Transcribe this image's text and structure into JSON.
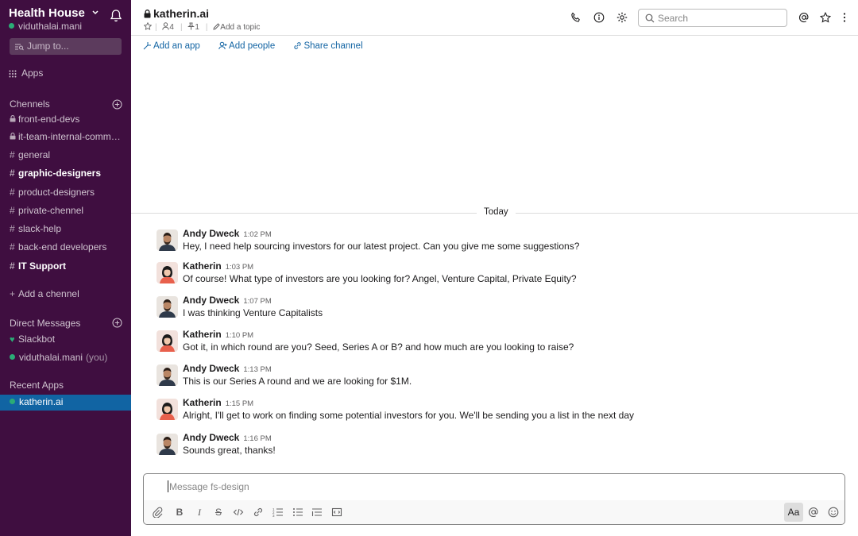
{
  "workspace": {
    "name": "Health House",
    "user": "viduthalai.mani"
  },
  "jump": {
    "label": "Jump to..."
  },
  "apps": {
    "label": "Apps"
  },
  "channels": {
    "title": "Chennels",
    "items": [
      {
        "prefix": "lock",
        "label": "front-end-devs",
        "bold": false
      },
      {
        "prefix": "lock",
        "label": "it-team-internal-commu...",
        "bold": false
      },
      {
        "prefix": "#",
        "label": "general",
        "bold": false
      },
      {
        "prefix": "#",
        "label": "graphic-designers",
        "bold": true
      },
      {
        "prefix": "#",
        "label": "product-designers",
        "bold": false
      },
      {
        "prefix": "#",
        "label": "private-chennel",
        "bold": false
      },
      {
        "prefix": "#",
        "label": "slack-help",
        "bold": false
      },
      {
        "prefix": "#",
        "label": "back-end developers",
        "bold": false
      },
      {
        "prefix": "#",
        "label": "IT Support",
        "bold": true
      }
    ],
    "add_label": "Add a chennel"
  },
  "direct_messages": {
    "title": "Direct Messages",
    "items": [
      {
        "label": "Slackbot"
      },
      {
        "label": "viduthalai.mani",
        "suffix": "(you)"
      }
    ]
  },
  "recent_apps": {
    "title": "Recent Apps",
    "items": [
      {
        "label": "katherin.ai",
        "active": true
      }
    ]
  },
  "header": {
    "channel": "katherin.ai",
    "members": "4",
    "pins": "1",
    "topic": "Add a topic",
    "search_placeholder": "Search"
  },
  "subbar": {
    "add_app": "Add an app",
    "add_people": "Add people",
    "share": "Share channel"
  },
  "divider": {
    "label": "Today"
  },
  "messages": [
    {
      "author": "Andy Dweck",
      "time": "1:02 PM",
      "text": "Hey, I need help sourcing investors for our latest project. Can you give me some suggestions?",
      "avatar": "andy-avatar"
    },
    {
      "author": "Katherin",
      "time": "1:03 PM",
      "text": "Of course! What type of investors are you looking for? Angel, Venture Capital, Private Equity?",
      "avatar": "katherin-avatar"
    },
    {
      "author": "Andy Dweck",
      "time": "1:07 PM",
      "text": "I was thinking Venture Capitalists",
      "avatar": "andy-avatar"
    },
    {
      "author": "Katherin",
      "time": "1:10 PM",
      "text": "Got it, in which round are you? Seed, Series A or B? and how much are you looking to raise?",
      "avatar": "katherin-avatar"
    },
    {
      "author": "Andy Dweck",
      "time": "1:13 PM",
      "text": "This is our Series A round and we are looking for $1M.",
      "avatar": "andy-avatar"
    },
    {
      "author": "Katherin",
      "time": "1:15 PM",
      "text": "Alright, I'll get to work on finding some potential investors for you. We'll be sending you a list in the next day",
      "avatar": "katherin-avatar"
    },
    {
      "author": "Andy Dweck",
      "time": "1:16 PM",
      "text": "Sounds great, thanks!",
      "avatar": "andy-avatar"
    }
  ],
  "composer": {
    "placeholder": "Message fs-design",
    "format_label": "Aa",
    "tools": [
      "attach-icon",
      "bold-icon",
      "italic-icon",
      "strikethrough-icon",
      "code-icon",
      "link-icon",
      "ordered-list-icon",
      "bulleted-list-icon",
      "blockquote-icon",
      "code-block-icon",
      "mention-icon",
      "emoji-icon"
    ]
  },
  "colors": {
    "sidebar": "#3f0e40",
    "active": "#1164a3",
    "online": "#2bac76",
    "link": "#1264a3"
  }
}
